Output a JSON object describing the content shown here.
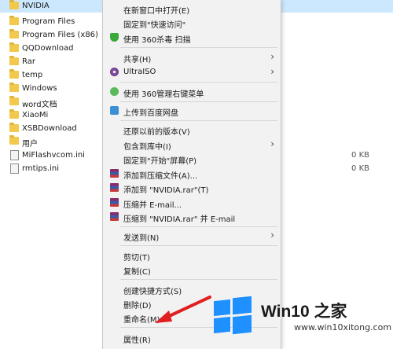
{
  "files": [
    {
      "name": "NVIDIA",
      "type": "folder",
      "selected": true
    },
    {
      "name": "Program Files",
      "type": "folder"
    },
    {
      "name": "Program Files (x86)",
      "type": "folder"
    },
    {
      "name": "QQDownload",
      "type": "folder"
    },
    {
      "name": "Rar",
      "type": "folder"
    },
    {
      "name": "temp",
      "type": "folder"
    },
    {
      "name": "Windows",
      "type": "folder"
    },
    {
      "name": "word文档",
      "type": "folder"
    },
    {
      "name": "XiaoMi",
      "type": "folder"
    },
    {
      "name": "XSBDownload",
      "type": "folder"
    },
    {
      "name": "用户",
      "type": "folder"
    },
    {
      "name": "MiFlashvcom.ini",
      "type": "file",
      "size": "0 KB"
    },
    {
      "name": "rmtips.ini",
      "type": "file",
      "size": "0 KB"
    }
  ],
  "menu": {
    "open_new_window": "在新窗口中打开(E)",
    "pin_quick_access": "固定到\"快速访问\"",
    "scan_360": "使用 360杀毒 扫描",
    "share": "共享(H)",
    "ultraiso": "UltraISO",
    "menu_360": "使用 360管理右键菜单",
    "baidu_upload": "上传到百度网盘",
    "restore_prev": "还原以前的版本(V)",
    "include_library": "包含到库中(I)",
    "pin_start": "固定到\"开始\"屏幕(P)",
    "add_archive": "添加到压缩文件(A)...",
    "add_rar": "添加到 \"NVIDIA.rar\"(T)",
    "compress_email": "压缩并 E-mail...",
    "compress_rar_email": "压缩到 \"NVIDIA.rar\" 并 E-mail",
    "send_to": "发送到(N)",
    "cut": "剪切(T)",
    "copy": "复制(C)",
    "create_shortcut": "创建快捷方式(S)",
    "delete": "删除(D)",
    "rename": "重命名(M)",
    "properties": "属性(R)"
  },
  "watermark": {
    "brand": "Win10 之家",
    "url": "www.win10xitong.com"
  },
  "colors": {
    "selection": "#cce8ff",
    "menu_bg": "#f2f2f2",
    "arrow": "#e02020",
    "win_blue": "#1e90ff"
  }
}
